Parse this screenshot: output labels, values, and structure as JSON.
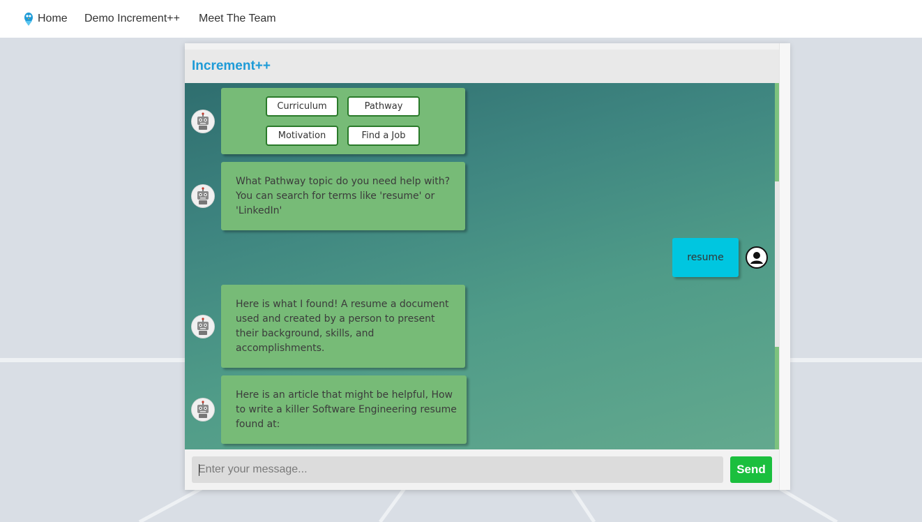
{
  "navbar": {
    "items": [
      {
        "label": "Home"
      },
      {
        "label": "Demo Increment++"
      },
      {
        "label": "Meet The Team"
      }
    ]
  },
  "chat": {
    "title": "Increment++",
    "options": [
      "Curriculum",
      "Pathway",
      "Motivation",
      "Find a Job"
    ],
    "messages": [
      {
        "sender": "bot",
        "text": "What Pathway topic do you need help with? You can search for terms like 'resume' or 'LinkedIn'"
      },
      {
        "sender": "user",
        "text": "resume"
      },
      {
        "sender": "bot",
        "text": "Here is what I found! A resume a document used and created by a person to present their background, skills, and accomplishments."
      },
      {
        "sender": "bot",
        "text": "Here is an article that might be helpful, How to write a killer Software Engineering resume found at:"
      }
    ],
    "input": {
      "placeholder": "Enter your message...",
      "value": ""
    },
    "send_label": "Send"
  },
  "colors": {
    "title": "#1e9bd7",
    "bot_bubble": "#77bb77",
    "user_bubble": "#00c6e0",
    "send_button": "#1bbf3e",
    "chip_border": "#2a7a2a"
  }
}
